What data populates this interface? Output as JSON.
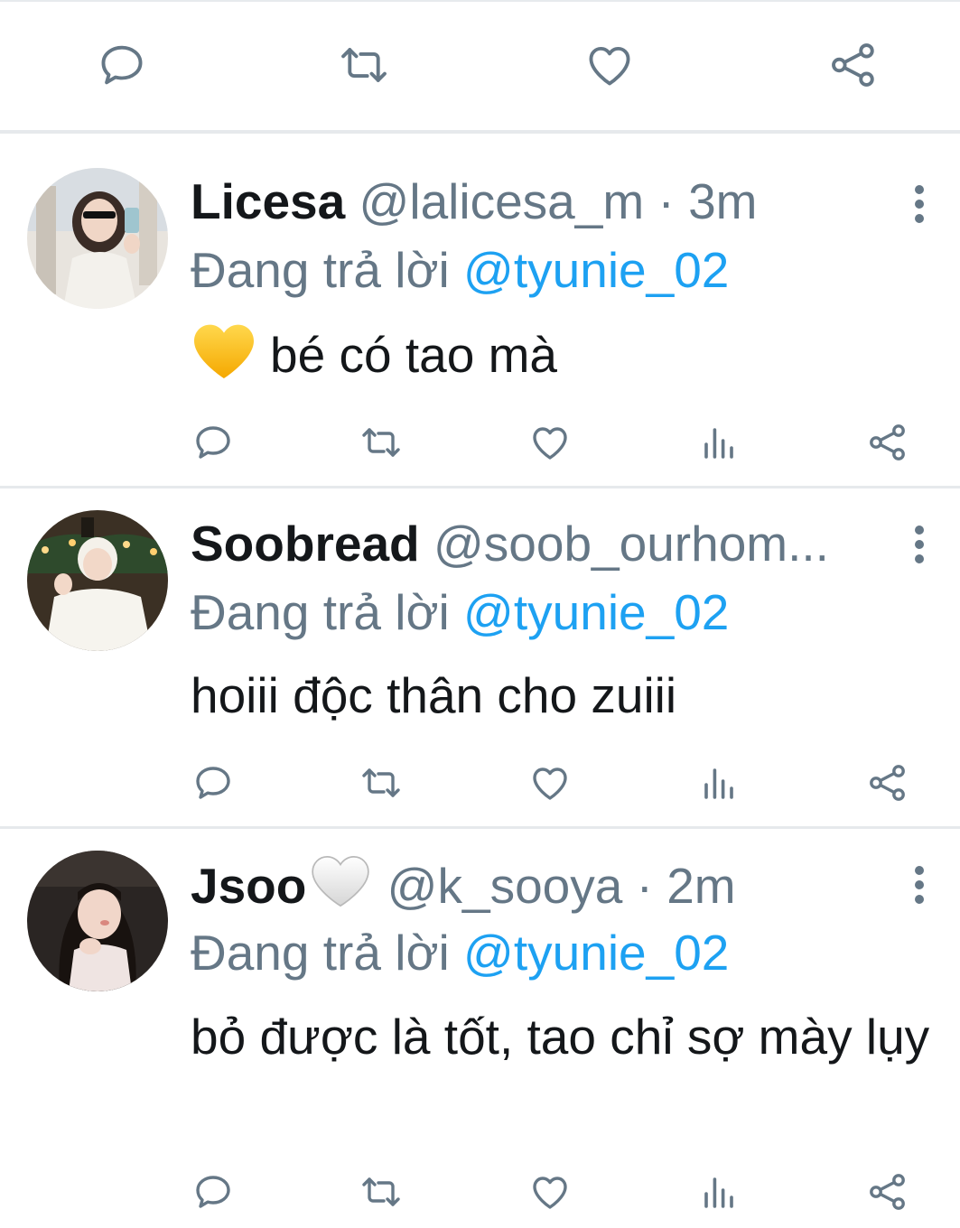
{
  "top_actions": {
    "icons": [
      "reply-icon",
      "retweet-icon",
      "like-icon",
      "share-icon"
    ],
    "color": "#657786"
  },
  "colors": {
    "name": "#14171a",
    "secondary": "#657786",
    "mention": "#1da1f2",
    "divider": "#e6e9ec"
  },
  "tweets": [
    {
      "name": "Licesa",
      "handle": "@lalicesa_m",
      "time": "· 3m",
      "reply_prefix": "Đang trả lời",
      "reply_to": "@tyunie_02",
      "text": "bé có tao mà",
      "text_emoji": "yellow-heart-emoji",
      "name_emoji": "",
      "avatar_desc": "avatar-photo"
    },
    {
      "name": "Soobread",
      "handle": "@soob_ourhom...",
      "time": "",
      "reply_prefix": "Đang trả lời",
      "reply_to": "@tyunie_02",
      "text": "hoiii độc thân cho zuiii",
      "text_emoji": "",
      "name_emoji": "",
      "avatar_desc": "avatar-photo"
    },
    {
      "name": "Jsoo",
      "handle": "@k_sooya",
      "time": "· 2m",
      "reply_prefix": "Đang trả lời",
      "reply_to": "@tyunie_02",
      "text": "bỏ được là tốt, tao chỉ sợ mày lụy",
      "text_emoji": "",
      "name_emoji": "white-heart-emoji",
      "avatar_desc": "avatar-photo"
    }
  ]
}
